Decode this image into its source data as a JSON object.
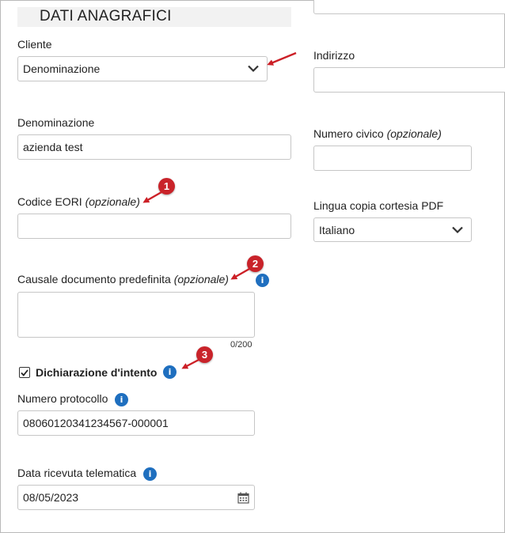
{
  "section": {
    "title": "DATI ANAGRAFICI"
  },
  "cliente": {
    "label": "Cliente",
    "selected": "Denominazione"
  },
  "indirizzo": {
    "label": "Indirizzo",
    "value": ""
  },
  "denominazione": {
    "label": "Denominazione",
    "value": "azienda test"
  },
  "numero_civico": {
    "label": "Numero civico",
    "optional": "(opzionale)",
    "value": ""
  },
  "codice_eori": {
    "label": "Codice EORI",
    "optional": "(opzionale)",
    "value": ""
  },
  "lingua": {
    "label": "Lingua copia cortesia PDF",
    "selected": "Italiano"
  },
  "causale": {
    "label": "Causale documento predefinita",
    "optional": "(opzionale)",
    "value": "",
    "counter": "0/200"
  },
  "dichiarazione": {
    "label": "Dichiarazione d'intento",
    "checked": true
  },
  "numero_protocollo": {
    "label": "Numero protocollo",
    "value": "08060120341234567-000001"
  },
  "data_ricevuta": {
    "label": "Data ricevuta telematica",
    "value": "08/05/2023"
  },
  "info_icon_glyph": "i",
  "badges": [
    "1",
    "2",
    "3"
  ],
  "colors": {
    "accent_info": "#1f6fbf",
    "annotation_red": "#c9232a",
    "arrow": "#cc2027"
  },
  "icons": [
    "chevron-down-icon",
    "info-icon",
    "checkmark-icon",
    "calendar-icon",
    "annotation-arrow"
  ]
}
